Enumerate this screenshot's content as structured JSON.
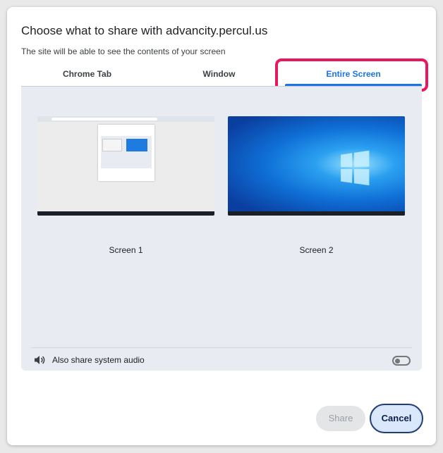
{
  "dialog": {
    "title": "Choose what to share with advancity.percul.us",
    "subtitle": "The site will be able to see the contents of your screen"
  },
  "tabs": [
    {
      "label": "Chrome Tab",
      "selected": false
    },
    {
      "label": "Window",
      "selected": false
    },
    {
      "label": "Entire Screen",
      "selected": true
    }
  ],
  "screens": [
    {
      "label": "Screen 1"
    },
    {
      "label": "Screen 2"
    }
  ],
  "audio": {
    "label": "Also share system audio",
    "enabled": false
  },
  "buttons": {
    "share": "Share",
    "cancel": "Cancel"
  },
  "colors": {
    "accent": "#1a73e8",
    "highlight": "#e8185e",
    "panel": "#e8ebf1"
  }
}
